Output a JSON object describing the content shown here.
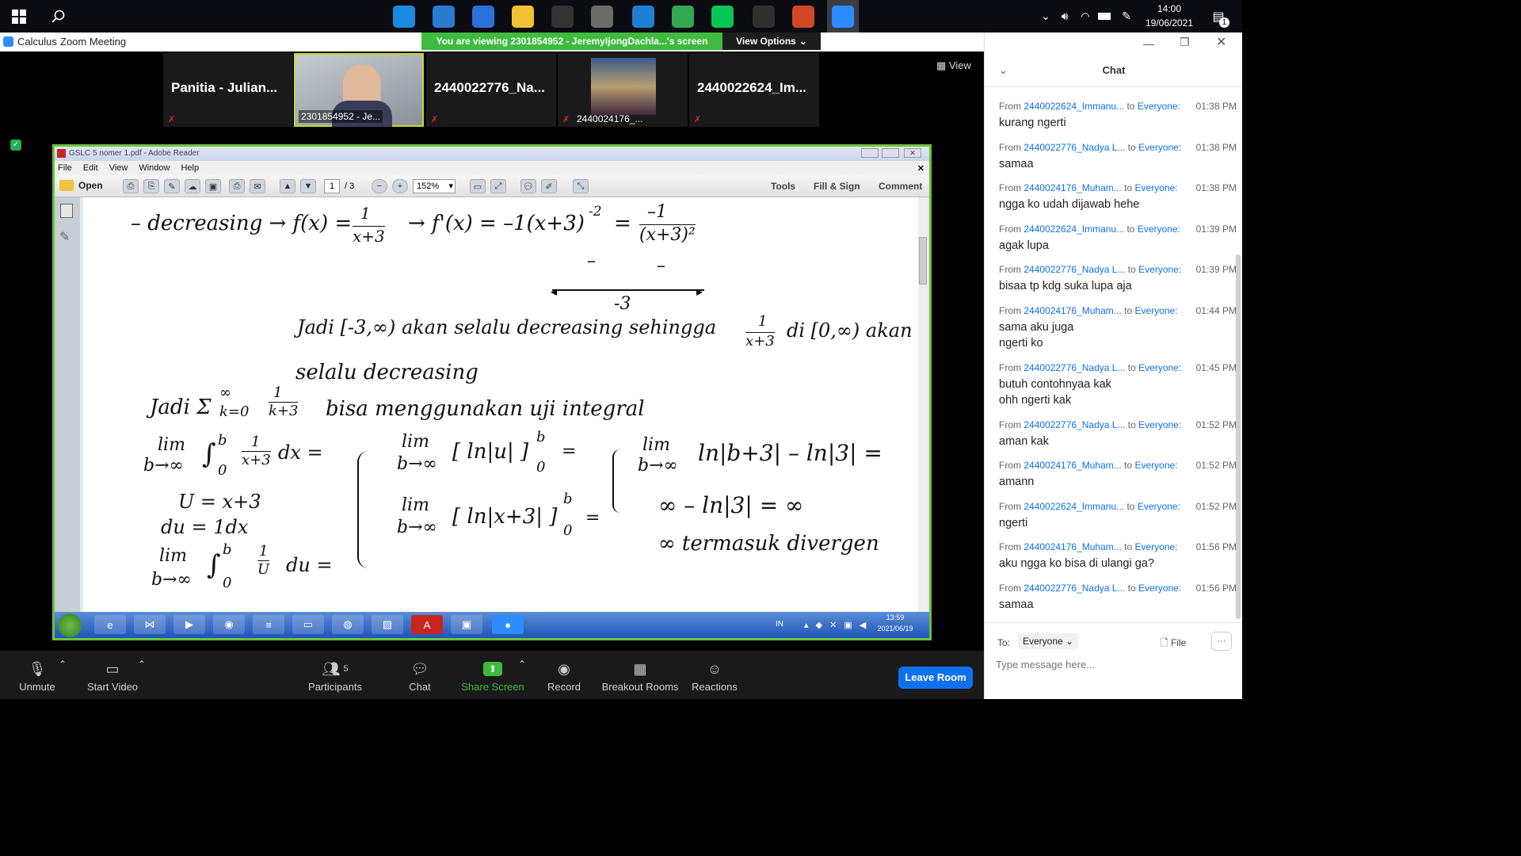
{
  "taskbar": {
    "apps": [
      {
        "icon": "edge-icon",
        "color": "#1a8adf"
      },
      {
        "icon": "mail-icon",
        "color": "#2a7ad2"
      },
      {
        "icon": "todo-icon",
        "color": "#2b6fdb"
      },
      {
        "icon": "file-explorer-icon",
        "color": "#f1c232"
      },
      {
        "icon": "ditto-icon",
        "color": "#333333"
      },
      {
        "icon": "snipping-icon",
        "color": "#6b6b6b"
      },
      {
        "icon": "vscode-icon",
        "color": "#1f7fd4"
      },
      {
        "icon": "chrome-icon",
        "color": "#34a853"
      },
      {
        "icon": "line-icon",
        "color": "#06c755"
      },
      {
        "icon": "obs-icon",
        "color": "#303030"
      },
      {
        "icon": "powerpoint-icon",
        "color": "#d24726"
      },
      {
        "icon": "zoom-icon",
        "color": "#2d8cff"
      }
    ],
    "clock": {
      "time": "14:00",
      "date": "19/06/2021"
    },
    "notification_count": "1"
  },
  "zoom": {
    "app_title": "Calculus",
    "window_title": "Zoom Meeting",
    "viewing_banner": "You are viewing 2301854952 - JeremyIjongDachla...'s screen",
    "view_options": "View Options",
    "view_btn": "View",
    "participants": [
      {
        "name": "Panitia - Julian...",
        "label": ""
      },
      {
        "name": "",
        "label": "2301854952 - Je..."
      },
      {
        "name": "2440022776_Na...",
        "label": ""
      },
      {
        "name": "",
        "label": "2440024176_..."
      },
      {
        "name": "2440022624_Im...",
        "label": ""
      }
    ],
    "controls": {
      "unmute": "Unmute",
      "start_video": "Start Video",
      "participants": "Participants",
      "participants_count": "5",
      "chat": "Chat",
      "share_screen": "Share Screen",
      "record": "Record",
      "breakout_rooms": "Breakout Rooms",
      "reactions": "Reactions",
      "leave_room": "Leave Room"
    }
  },
  "adobe": {
    "title": "GSLC 5 nomer 1.pdf - Adobe Reader",
    "menu": [
      "File",
      "Edit",
      "View",
      "Window",
      "Help"
    ],
    "open_label": "Open",
    "page_current": "1",
    "page_total": "/ 3",
    "zoom": "152%",
    "tools": "Tools",
    "fill_sign": "Fill & Sign",
    "comment": "Comment",
    "handwriting": {
      "l1a": "– decreasing → f(x) = ",
      "l1b": "1",
      "l1c": "x+3",
      "l1d": "→ f'(x) = –1(x+3)",
      "l1e": "-2",
      "l1f": "=",
      "l1g": "–1",
      "l1h": "(x+3)²",
      "nl_minus1": "–",
      "nl_minus2": "–",
      "nl_point": "-3",
      "l2": "Jadi [-3,∞) akan selalu decreasing sehingga",
      "l2f_num": "1",
      "l2f_den": "x+3",
      "l2end": "di [0,∞) akan",
      "l3": "selalu decreasing",
      "l4": "Jadi Σ",
      "l4sup": "∞",
      "l4sub": "k=0",
      "l4num": "1",
      "l4den": "k+3",
      "l4end": "bisa menggunakan uji integral",
      "a1": "lim",
      "a2": "b→∞",
      "a3": "∫",
      "a3sup": "b",
      "a3sub": "0",
      "a3num": "1",
      "a3den": "x+3",
      "a3end": "dx =",
      "u1": "U = x+3",
      "u2": "du = 1dx",
      "c1": "lim",
      "c2": "b→∞",
      "c3": "∫",
      "c3sup": "b",
      "c3sub": "0",
      "c3num": "1",
      "c3den": "U",
      "c3end": "du =",
      "m1a": "lim",
      "m1b": "b→∞",
      "m1c": "[ ln|u| ]",
      "m1sup": "b",
      "m1sub": "0",
      "m1eq": "=",
      "m2a": "lim",
      "m2b": "b→∞",
      "m2c": "[ ln|x+3| ]",
      "m2sup": "b",
      "m2sub": "0",
      "m2eq": "=",
      "r1a": "lim",
      "r1b": "b→∞",
      "r1c": "ln|b+3| – ln|3| =",
      "r2": "∞ – ln|3| = ∞",
      "r3": "∞ termasuk divergen"
    },
    "xp_clock": {
      "time": "13:59",
      "date": "2021/06/19"
    },
    "xp_lang": "IN"
  },
  "chat": {
    "title": "Chat",
    "messages": [
      {
        "from": "2440022624_Immanu...",
        "to": "Everyone:",
        "time": "01:38 PM",
        "lines": [
          "kurang ngerti"
        ]
      },
      {
        "from": "2440022776_Nadya L...",
        "to": "Everyone:",
        "time": "01:38 PM",
        "lines": [
          "samaa"
        ]
      },
      {
        "from": "2440024176_Muham...",
        "to": "Everyone:",
        "time": "01:38 PM",
        "lines": [
          "ngga ko udah dijawab hehe"
        ]
      },
      {
        "from": "2440022624_Immanu...",
        "to": "Everyone:",
        "time": "01:39 PM",
        "lines": [
          "agak lupa"
        ]
      },
      {
        "from": "2440022776_Nadya L...",
        "to": "Everyone:",
        "time": "01:39 PM",
        "lines": [
          "bisaa tp kdg suka lupa aja"
        ]
      },
      {
        "from": "2440024176_Muham...",
        "to": "Everyone:",
        "time": "01:44 PM",
        "lines": [
          "sama aku juga",
          "ngerti ko"
        ]
      },
      {
        "from": "2440022776_Nadya L...",
        "to": "Everyone:",
        "time": "01:45 PM",
        "lines": [
          "butuh contohnyaa kak",
          "ohh ngerti kak"
        ]
      },
      {
        "from": "2440022776_Nadya L...",
        "to": "Everyone:",
        "time": "01:52 PM",
        "lines": [
          "aman kak"
        ]
      },
      {
        "from": "2440024176_Muham...",
        "to": "Everyone:",
        "time": "01:52 PM",
        "lines": [
          "amann"
        ]
      },
      {
        "from": "2440022624_Immanu...",
        "to": "Everyone:",
        "time": "01:52 PM",
        "lines": [
          "ngerti"
        ]
      },
      {
        "from": "2440024176_Muham...",
        "to": "Everyone:",
        "time": "01:56 PM",
        "lines": [
          "aku ngga ko bisa di ulangi ga?"
        ]
      },
      {
        "from": "2440022776_Nadya L...",
        "to": "Everyone:",
        "time": "01:56 PM",
        "lines": [
          "samaa"
        ]
      }
    ],
    "from_prefix": "From",
    "to_prefix": "to",
    "to_label": "To:",
    "to_value": "Everyone",
    "file_label": "File",
    "more_label": "···",
    "input_placeholder": "Type message here..."
  }
}
